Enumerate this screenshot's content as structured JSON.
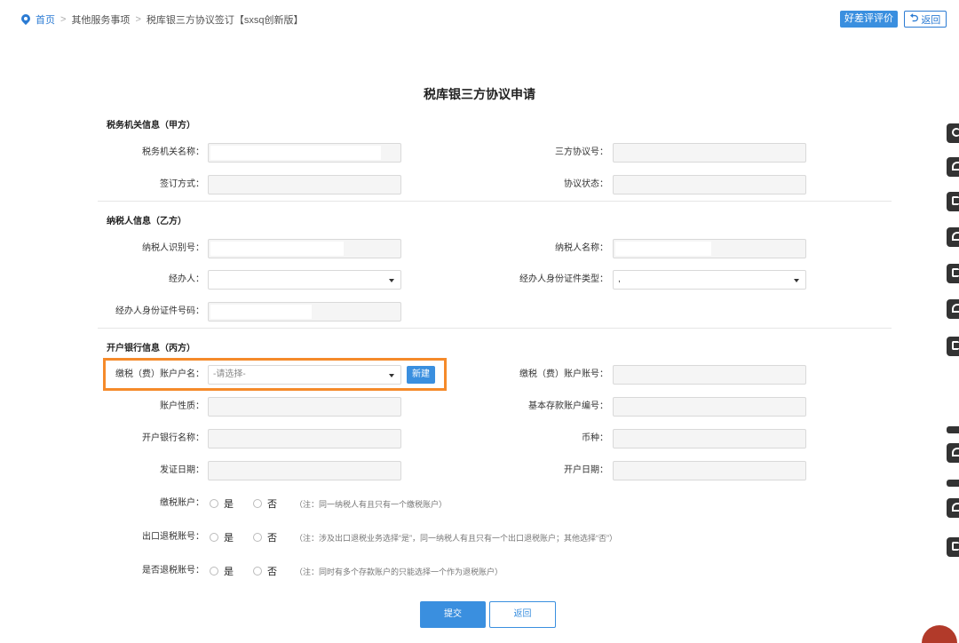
{
  "breadcrumb": {
    "home": "首页",
    "sep1": ">",
    "level2": "其他服务事项",
    "sep2": ">",
    "level3": "税库银三方协议签订【sxsq创新版】"
  },
  "header": {
    "rate_button": "好差评评价",
    "back_button": "返回",
    "back_icon_glyph": "⮌"
  },
  "title": "税库银三方协议申请",
  "sections": {
    "tax_authority": "税务机关信息（甲方）",
    "taxpayer": "纳税人信息（乙方）",
    "bank": "开户银行信息（丙方）"
  },
  "labels": {
    "tax_office_name": "税务机关名称：",
    "agreement_no": "三方协议号：",
    "sign_method": "签订方式：",
    "agreement_status": "协议状态：",
    "taxpayer_id": "纳税人识别号：",
    "taxpayer_name": "纳税人名称：",
    "handler": "经办人：",
    "handler_id_type": "经办人身份证件类型：",
    "handler_id_no": "经办人身份证件号码：",
    "pay_account_name": "缴税（费）账户户名：",
    "pay_account_no": "缴税（费）账户账号：",
    "account_nature": "账户性质：",
    "basic_account_code": "基本存款账户编号：",
    "bank_name": "开户银行名称：",
    "currency": "币种：",
    "issue_date": "发证日期：",
    "open_date": "开户日期：",
    "pay_account": "缴税账户：",
    "export_refund_account": "出口退税账号：",
    "refund_account": "是否退税账号："
  },
  "values": {
    "handler_id_type_value": ","
  },
  "pay_account_select": {
    "placeholder": "-请选择-",
    "new_button": "新建"
  },
  "radios": {
    "yes": "是",
    "no": "否",
    "pay_account_note": "（注：同一纳税人有且只有一个缴税账户）",
    "export_refund_note": "（注：涉及出口退税业务选择“是”，同一纳税人有且只有一个出口退税账户；其他选择“否”）",
    "refund_note": "（注：同时有多个存款账户的只能选择一个作为退税账户）"
  },
  "buttons": {
    "submit": "提交",
    "return": "返回"
  },
  "colors": {
    "accent": "#3a8fdf",
    "highlight": "#f58a2a"
  }
}
